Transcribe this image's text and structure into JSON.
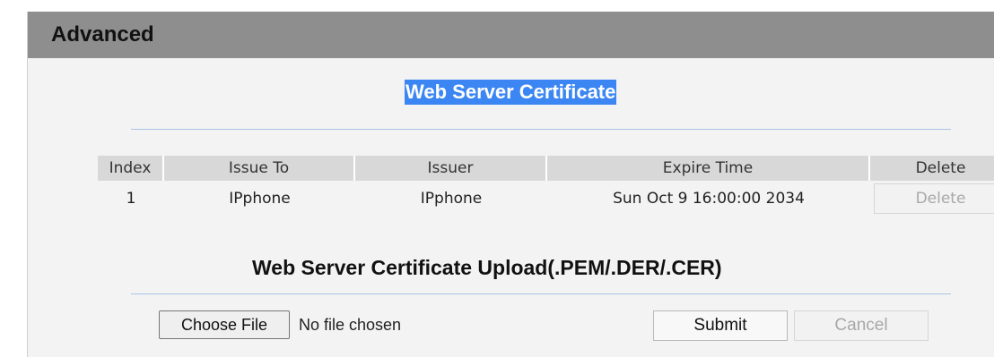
{
  "panel": {
    "title": "Advanced"
  },
  "certificates": {
    "title": "Web Server Certificate",
    "columns": {
      "index": "Index",
      "issue_to": "Issue To",
      "issuer": "Issuer",
      "expire_time": "Expire Time",
      "delete": "Delete"
    },
    "rows": [
      {
        "index": "1",
        "issue_to": "IPphone",
        "issuer": "IPphone",
        "expire_time": "Sun Oct 9 16:00:00 2034",
        "delete_label": "Delete"
      }
    ]
  },
  "upload": {
    "title": "Web Server Certificate Upload(.PEM/.DER/.CER)",
    "choose_file_label": "Choose File",
    "file_status": "No file chosen",
    "submit_label": "Submit",
    "cancel_label": "Cancel"
  },
  "colors": {
    "header_bar": "#8e8e8e",
    "panel_bg": "#f3f3f3",
    "selection_highlight": "#3b86f2",
    "divider": "#aac4e8",
    "table_header_bg": "#d8d8d8"
  }
}
